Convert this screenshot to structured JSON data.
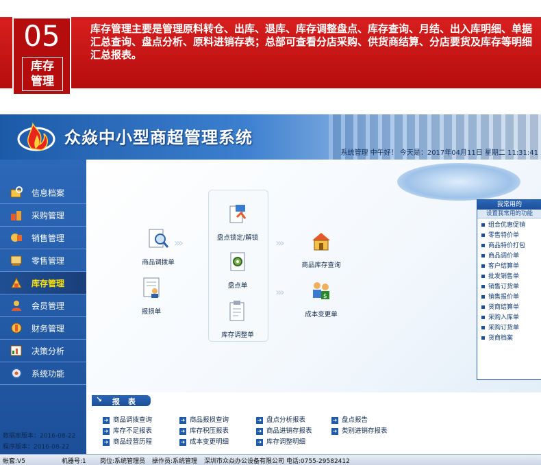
{
  "banner": {
    "number": "05",
    "label_line1": "库存",
    "label_line2": "管理",
    "text": "库存管理主要是管理原料转仓、出库、退库、库存调整盘点、库存查询、月结、出入库明细、单据汇总查询、盘点分析、原料进销存表；总部可查看分店采购、供货商结算、分店要货及库存等明细汇总报表。"
  },
  "app": {
    "title": "众焱中小型商超管理系统",
    "status": "系统管理  中午好！ 今天是：2017年04月11日  星期二  11:31:41"
  },
  "sidebar": {
    "items": [
      {
        "label": "信息档案",
        "icon": "archive-icon",
        "active": false
      },
      {
        "label": "采购管理",
        "icon": "purchase-icon",
        "active": false
      },
      {
        "label": "销售管理",
        "icon": "sales-icon",
        "active": false
      },
      {
        "label": "零售管理",
        "icon": "retail-icon",
        "active": false
      },
      {
        "label": "库存管理",
        "icon": "inventory-icon",
        "active": true
      },
      {
        "label": "会员管理",
        "icon": "member-icon",
        "active": false
      },
      {
        "label": "财务管理",
        "icon": "finance-icon",
        "active": false
      },
      {
        "label": "决策分析",
        "icon": "analysis-icon",
        "active": false
      },
      {
        "label": "系统功能",
        "icon": "system-icon",
        "active": false
      }
    ],
    "db_version": "数据库版本：2016-08-22",
    "app_version": "程序版本：2016-08-22"
  },
  "flow": {
    "transfer": "商品调拨单",
    "loss": "报损单",
    "lock": "盘点锁定/解锁",
    "count": "盘点单",
    "adjust": "库存调整单",
    "query": "商品库存查询",
    "cost": "成本变更单"
  },
  "right_panel": {
    "title": "我常用的",
    "subtitle": "设置我常用的功能",
    "items": [
      "组合优惠促销",
      "零售特价单",
      "商品特价打包",
      "商品调价单",
      "客户结算单",
      "批发销售单",
      "销售订货单",
      "销售报价单",
      "货商结算单",
      "采购入库单",
      "采购订货单",
      "货商档案"
    ]
  },
  "reports": {
    "tab_label": "报 表",
    "items": [
      "商品调拨查询",
      "商品报损查询",
      "盘点分析报表",
      "盘点报告",
      "库存不足报表",
      "库存积压报表",
      "商品进销存报表",
      "类别进销存报表",
      "商品经营历程",
      "成本变更明细",
      "库存调整明细"
    ]
  },
  "status_bar": {
    "version": "帐套:V5",
    "machine": "机器号:1",
    "post": "岗位:系统管理员",
    "operator": "操作员:系统管理",
    "company": "深圳市众焱办公设备有限公司  电话:0755-29582412"
  }
}
